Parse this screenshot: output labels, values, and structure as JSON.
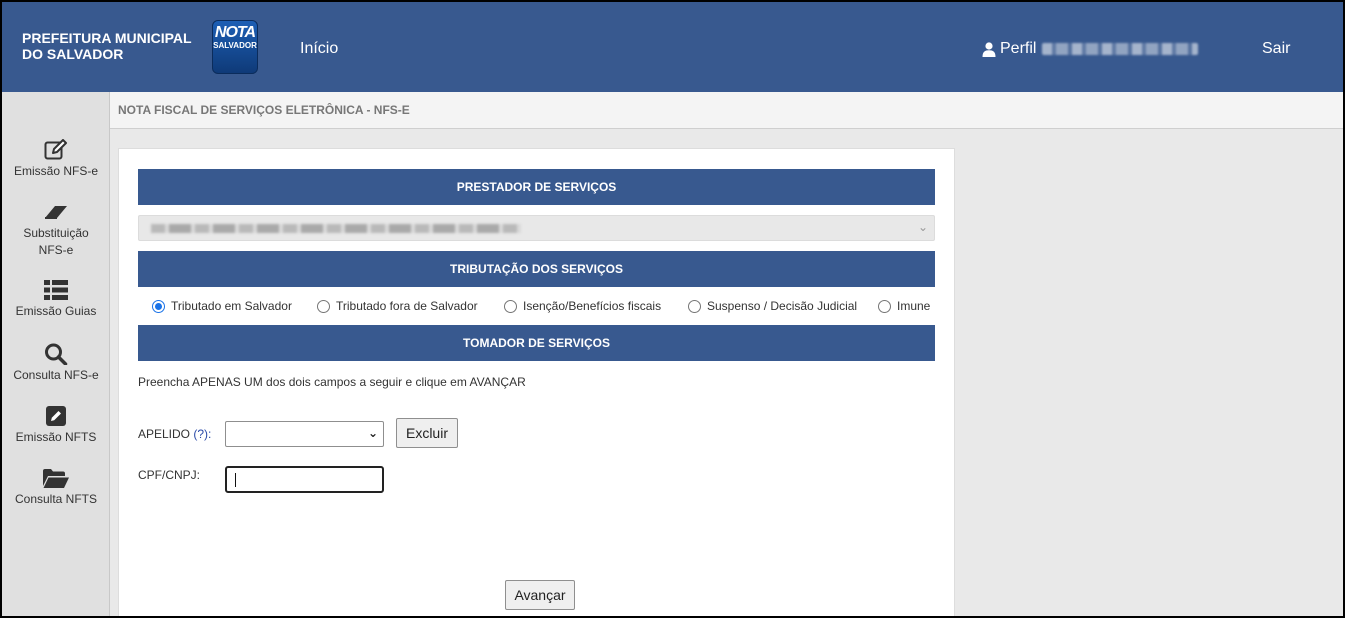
{
  "header": {
    "org_line1": "PREFEITURA MUNICIPAL",
    "org_line2": "DO SALVADOR",
    "logo_line1": "NOTA",
    "logo_line2": "SALVADOR",
    "nav_inicio": "Início",
    "perfil_label": "Perfil",
    "sair_label": "Sair"
  },
  "breadcrumb": "NOTA FISCAL DE SERVIÇOS ELETRÔNICA - NFS-E",
  "sidebar": {
    "items": [
      {
        "label": "Emissão NFS-e",
        "icon": "edit-icon"
      },
      {
        "label": "Substituição NFS-e",
        "icon": "eraser-icon"
      },
      {
        "label": "Emissão Guias",
        "icon": "list-icon"
      },
      {
        "label": "Consulta NFS-e",
        "icon": "search-icon"
      },
      {
        "label": "Emissão NFTS",
        "icon": "pencil-square-icon"
      },
      {
        "label": "Consulta NFTS",
        "icon": "folder-open-icon"
      }
    ]
  },
  "main": {
    "prestador_title": "PRESTADOR DE SERVIÇOS",
    "tributacao_title": "TRIBUTAÇÃO DOS SERVIÇOS",
    "tributacao_options": [
      {
        "label": "Tributado em Salvador",
        "selected": true
      },
      {
        "label": "Tributado fora de Salvador",
        "selected": false
      },
      {
        "label": "Isenção/Benefícios fiscais",
        "selected": false
      },
      {
        "label": "Suspenso / Decisão Judicial",
        "selected": false
      },
      {
        "label": "Imune",
        "selected": false
      }
    ],
    "tomador_title": "TOMADOR DE SERVIÇOS",
    "instructions": "Preencha APENAS UM dos dois campos a seguir e clique em AVANÇAR",
    "apelido_label": "APELIDO",
    "apelido_help": "(?):",
    "apelido_value": "",
    "excluir_label": "Excluir",
    "cpf_label": "CPF/CNPJ:",
    "cpf_value": "",
    "avancar_label": "Avançar"
  },
  "colors": {
    "header_bg": "#38598f",
    "accent": "#1a73e8"
  }
}
